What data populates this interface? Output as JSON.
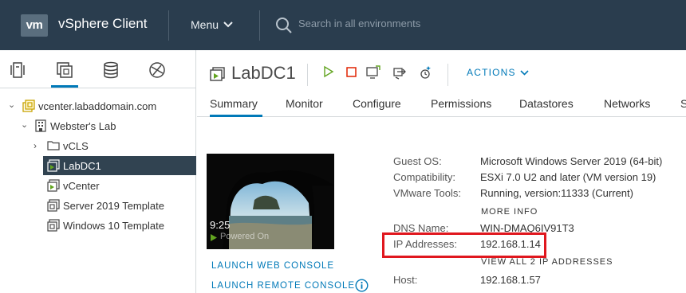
{
  "header": {
    "logo_text": "vm",
    "app_title": "vSphere Client",
    "menu_label": "Menu",
    "search_placeholder": "Search in all environments"
  },
  "navigator": {
    "tabs": [
      {
        "name": "hosts-and-clusters",
        "icon": "hosts-clusters-icon"
      },
      {
        "name": "vms-and-templates",
        "icon": "vms-templates-icon",
        "active": true
      },
      {
        "name": "storage",
        "icon": "storage-icon"
      },
      {
        "name": "networking",
        "icon": "networking-icon"
      }
    ],
    "tree": [
      {
        "label": "vcenter.labaddomain.com",
        "icon": "vcenter-icon",
        "expanded": true
      },
      {
        "label": "Webster's Lab",
        "icon": "datacenter-icon",
        "expanded": true
      },
      {
        "label": "vCLS",
        "icon": "folder-icon",
        "expanded": false
      },
      {
        "label": "LabDC1",
        "icon": "vm-icon",
        "selected": true
      },
      {
        "label": "vCenter",
        "icon": "vm-icon"
      },
      {
        "label": "Server 2019 Template",
        "icon": "template-icon"
      },
      {
        "label": "Windows 10 Template",
        "icon": "template-icon"
      }
    ]
  },
  "object": {
    "title": "LabDC1",
    "actions_label": "ACTIONS"
  },
  "tabs": [
    "Summary",
    "Monitor",
    "Configure",
    "Permissions",
    "Datastores",
    "Networks",
    "S"
  ],
  "console": {
    "time": "9:25",
    "overlay_text": "Powered On",
    "launch_web": "LAUNCH WEB CONSOLE",
    "launch_remote": "LAUNCH REMOTE CONSOLE"
  },
  "details": {
    "guest_os_label": "Guest OS:",
    "guest_os_value": "Microsoft Windows Server 2019 (64-bit)",
    "compat_label": "Compatibility:",
    "compat_value": "ESXi 7.0 U2 and later (VM version 19)",
    "tools_label": "VMware Tools:",
    "tools_value": "Running, version:11333 (Current)",
    "more_info": "MORE INFO",
    "dns_label": "DNS Name:",
    "dns_value": "WIN-DMAQ6IV91T3",
    "ip_label": "IP Addresses:",
    "ip_value": "192.168.1.14",
    "view_all_ip": "VIEW ALL 2 IP ADDRESSES",
    "host_label": "Host:",
    "host_value": "192.168.1.57"
  },
  "colors": {
    "topbar": "#2a3d4e",
    "accent": "#0079b8",
    "selected_row": "#314351",
    "highlight": "#e0171e",
    "power_on": "#62a420",
    "power_off": "#e12200"
  }
}
